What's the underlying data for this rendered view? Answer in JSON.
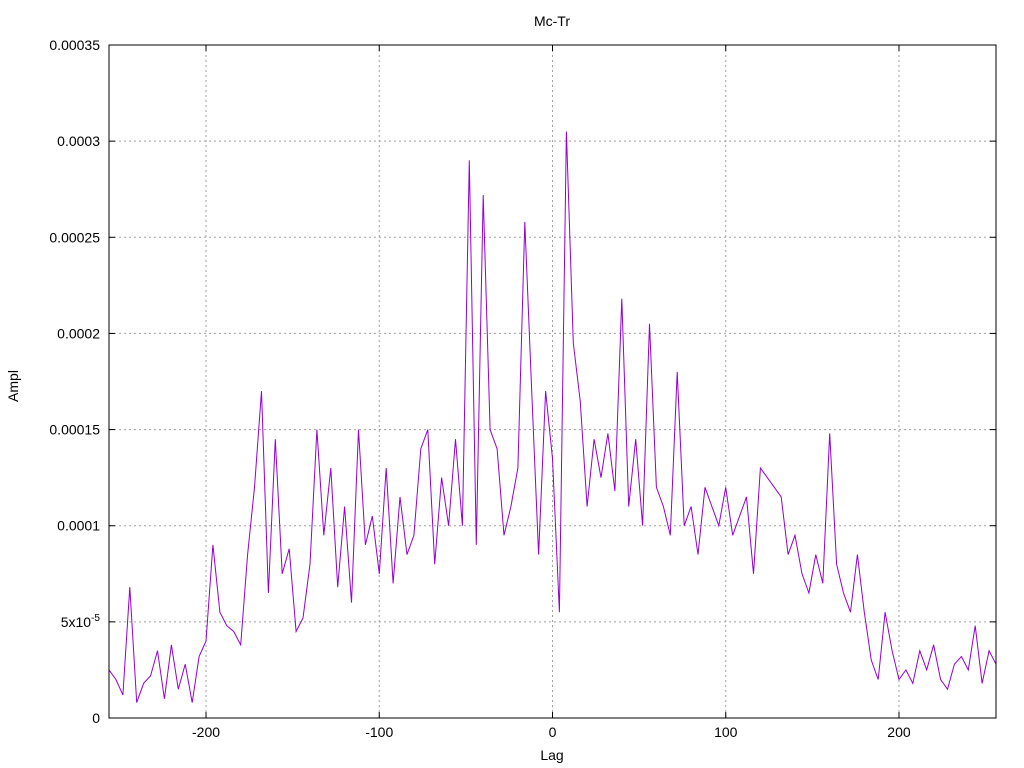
{
  "chart_data": {
    "type": "line",
    "title": "Mc-Tr",
    "xlabel": "Lag",
    "ylabel": "Ampl",
    "xlim": [
      -256,
      256
    ],
    "ylim": [
      0,
      0.00035
    ],
    "grid": true,
    "line_color": "#9400d3",
    "x_ticks": [
      {
        "value": -200,
        "label": "-200"
      },
      {
        "value": -100,
        "label": "-100"
      },
      {
        "value": 0,
        "label": "0"
      },
      {
        "value": 100,
        "label": "100"
      },
      {
        "value": 200,
        "label": "200"
      }
    ],
    "y_ticks": [
      {
        "value": 0,
        "label": "0"
      },
      {
        "value": 5e-05,
        "label": "5x10",
        "sup": "-5"
      },
      {
        "value": 0.0001,
        "label": "0.0001"
      },
      {
        "value": 0.00015,
        "label": "0.00015"
      },
      {
        "value": 0.0002,
        "label": "0.0002"
      },
      {
        "value": 0.00025,
        "label": "0.00025"
      },
      {
        "value": 0.0003,
        "label": "0.0003"
      },
      {
        "value": 0.00035,
        "label": "0.00035"
      }
    ],
    "series": [
      {
        "x": [
          -256,
          -252,
          -248,
          -244,
          -240,
          -236,
          -232,
          -228,
          -224,
          -220,
          -216,
          -212,
          -208,
          -204,
          -200,
          -196,
          -192,
          -188,
          -184,
          -180,
          -176,
          -172,
          -168,
          -164,
          -160,
          -156,
          -152,
          -148,
          -144,
          -140,
          -136,
          -132,
          -128,
          -124,
          -120,
          -116,
          -112,
          -108,
          -104,
          -100,
          -96,
          -92,
          -88,
          -84,
          -80,
          -76,
          -72,
          -68,
          -64,
          -60,
          -56,
          -52,
          -48,
          -44,
          -40,
          -36,
          -32,
          -28,
          -24,
          -20,
          -16,
          -12,
          -8,
          -4,
          0,
          4,
          8,
          12,
          16,
          20,
          24,
          28,
          32,
          36,
          40,
          44,
          48,
          52,
          56,
          60,
          64,
          68,
          72,
          76,
          80,
          84,
          88,
          92,
          96,
          100,
          104,
          108,
          112,
          116,
          120,
          124,
          128,
          132,
          136,
          140,
          144,
          148,
          152,
          156,
          160,
          164,
          168,
          172,
          176,
          180,
          184,
          188,
          192,
          196,
          200,
          204,
          208,
          212,
          216,
          220,
          224,
          228,
          232,
          236,
          240,
          244,
          248,
          252,
          256
        ],
        "values": [
          2.5e-05,
          2e-05,
          1.2e-05,
          6.8e-05,
          8e-06,
          1.8e-05,
          2.2e-05,
          3.5e-05,
          1e-05,
          3.8e-05,
          1.5e-05,
          2.8e-05,
          8e-06,
          3.2e-05,
          4e-05,
          9e-05,
          5.5e-05,
          4.8e-05,
          4.5e-05,
          3.8e-05,
          8.5e-05,
          0.00012,
          0.00017,
          6.5e-05,
          0.000145,
          7.5e-05,
          8.8e-05,
          4.5e-05,
          5.2e-05,
          8e-05,
          0.00015,
          9.5e-05,
          0.00013,
          6.8e-05,
          0.00011,
          6e-05,
          0.00015,
          9e-05,
          0.000105,
          7.5e-05,
          0.00013,
          7e-05,
          0.000115,
          8.5e-05,
          9.5e-05,
          0.00014,
          0.00015,
          8e-05,
          0.000125,
          0.0001,
          0.000145,
          0.0001,
          0.00029,
          9e-05,
          0.000272,
          0.00015,
          0.00014,
          9.5e-05,
          0.00011,
          0.00013,
          0.000258,
          0.00017,
          8.5e-05,
          0.00017,
          0.000135,
          5.5e-05,
          0.000305,
          0.000195,
          0.000165,
          0.00011,
          0.000145,
          0.000125,
          0.000148,
          0.000118,
          0.000218,
          0.00011,
          0.000145,
          0.0001,
          0.000205,
          0.00012,
          0.00011,
          9.5e-05,
          0.00018,
          0.0001,
          0.00011,
          8.5e-05,
          0.00012,
          0.00011,
          0.0001,
          0.00012,
          9.5e-05,
          0.000105,
          0.000115,
          7.5e-05,
          0.00013,
          0.000125,
          0.00012,
          0.000115,
          8.5e-05,
          9.5e-05,
          7.5e-05,
          6.5e-05,
          8.5e-05,
          7e-05,
          0.000148,
          8e-05,
          6.5e-05,
          5.5e-05,
          8.5e-05,
          5.5e-05,
          3e-05,
          2e-05,
          5.5e-05,
          3.5e-05,
          2e-05,
          2.5e-05,
          1.8e-05,
          3.5e-05,
          2.5e-05,
          3.8e-05,
          2e-05,
          1.5e-05,
          2.8e-05,
          3.2e-05,
          2.5e-05,
          4.8e-05,
          1.8e-05,
          3.5e-05,
          2.8e-05
        ]
      }
    ]
  }
}
